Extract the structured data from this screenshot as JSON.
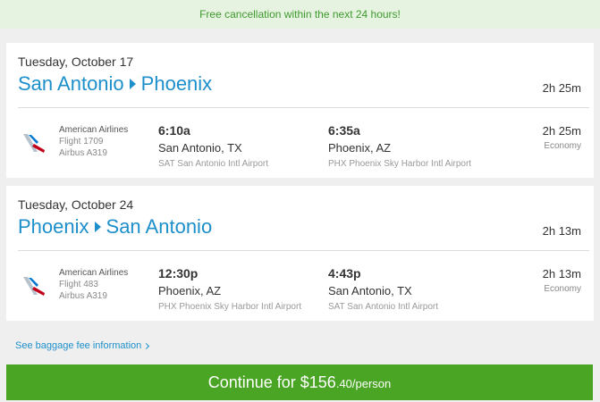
{
  "banner": {
    "text": "Free cancellation within the next 24 hours!"
  },
  "flights": [
    {
      "date": "Tuesday, October 17",
      "origin": "San Antonio",
      "destination": "Phoenix",
      "total_duration": "2h 25m",
      "segment": {
        "airline": "American Airlines",
        "flight": "Flight 1709",
        "aircraft": "Airbus A319",
        "dep_time": "6:10a",
        "dep_city": "San Antonio, TX",
        "dep_airport": "SAT San Antonio Intl Airport",
        "arr_time": "6:35a",
        "arr_city": "Phoenix, AZ",
        "arr_airport": "PHX Phoenix Sky Harbor Intl Airport",
        "duration": "2h 25m",
        "cabin": "Economy"
      }
    },
    {
      "date": "Tuesday, October 24",
      "origin": "Phoenix",
      "destination": "San Antonio",
      "total_duration": "2h 13m",
      "segment": {
        "airline": "American Airlines",
        "flight": "Flight 483",
        "aircraft": "Airbus A319",
        "dep_time": "12:30p",
        "dep_city": "Phoenix, AZ",
        "dep_airport": "PHX Phoenix Sky Harbor Intl Airport",
        "arr_time": "4:43p",
        "arr_city": "San Antonio, TX",
        "arr_airport": "SAT San Antonio Intl Airport",
        "duration": "2h 13m",
        "cabin": "Economy"
      }
    }
  ],
  "baggage_link": "See baggage fee information",
  "continue_button": {
    "prefix": "Continue for $156",
    "cents_suffix": ".40/person"
  },
  "icons": {
    "airline_logo": "american-airlines-logo-icon",
    "route_arrow": "triangle-right-icon",
    "baggage_chevron": "chevron-right-icon"
  },
  "colors": {
    "accent": "#1d8fcb",
    "banner_bg": "#e6f3e0",
    "banner_text": "#3f9a2f",
    "continue_bg": "#4aa524"
  }
}
